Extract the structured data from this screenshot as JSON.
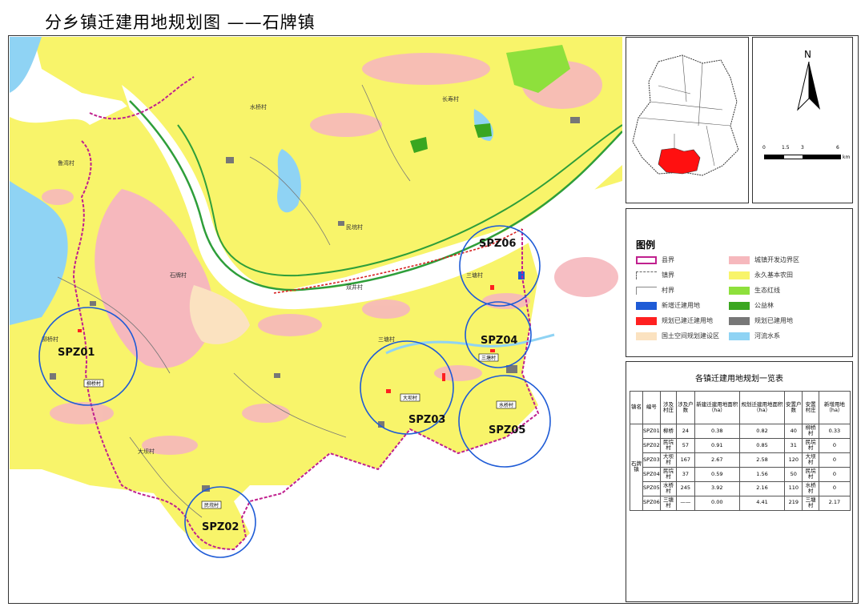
{
  "title": "分乡镇迁建用地规划图 ——石牌镇",
  "zones": [
    "SPZ01",
    "SPZ02",
    "SPZ03",
    "SPZ04",
    "SPZ05",
    "SPZ06"
  ],
  "village_tags": [
    "柳桥村",
    "三塘村",
    "大坝村",
    "民垸村",
    "水桥村"
  ],
  "map_labels": [
    "柳桥村",
    "三塘村",
    "大坝村",
    "民垸村",
    "水桥村",
    "双井村",
    "三塘村",
    "石牌村",
    "鲁湾村",
    "长寿村"
  ],
  "legend": {
    "title": "图例",
    "items": [
      {
        "label": "县界",
        "color": "#c0208e",
        "style": "outline"
      },
      {
        "label": "城镇开发边界区",
        "color": "#f6b8bd",
        "style": "fill"
      },
      {
        "label": "镇界",
        "color": "#666666",
        "style": "dash"
      },
      {
        "label": "永久基本农田",
        "color": "#f8f46a",
        "style": "fill"
      },
      {
        "label": "村界",
        "color": "#888888",
        "style": "line"
      },
      {
        "label": "生态红线",
        "color": "#8ee03c",
        "style": "fill"
      },
      {
        "label": "新增迁建用地",
        "color": "#1e5bd6",
        "style": "fill"
      },
      {
        "label": "公益林",
        "color": "#3aa620",
        "style": "fill"
      },
      {
        "label": "规划已建迁建用地",
        "color": "#ff2020",
        "style": "fill"
      },
      {
        "label": "规划已建用地",
        "color": "#777777",
        "style": "fill"
      },
      {
        "label": "国土空间规划建设区",
        "color": "#fbe2c0",
        "style": "fill"
      },
      {
        "label": "河流水系",
        "color": "#8fd3f4",
        "style": "fill"
      }
    ]
  },
  "table": {
    "title": "各镇迁建用地规划一览表",
    "headers": [
      "镇名",
      "编号",
      "涉及村庄",
      "涉及户数",
      "新建迁建用地面积（ha）",
      "规划迁建用地面积（ha）",
      "安置户数",
      "安置村庄",
      "新增用地（ha）"
    ],
    "town": "石牌镇",
    "rows": [
      [
        "SPZ01",
        "柳桥",
        "24",
        "0.38",
        "0.82",
        "40",
        "柳桥村",
        "0.33"
      ],
      [
        "SPZ02",
        "民垸村",
        "57",
        "0.91",
        "0.85",
        "31",
        "民垸村",
        "0"
      ],
      [
        "SPZ03",
        "大坝村",
        "167",
        "2.67",
        "2.58",
        "120",
        "大坝村",
        "0"
      ],
      [
        "SPZ04",
        "民垸村",
        "37",
        "0.59",
        "1.56",
        "50",
        "民垸村",
        "0"
      ],
      [
        "SPZ05",
        "水桥村",
        "245",
        "3.92",
        "2.16",
        "110",
        "水桥村",
        "0"
      ],
      [
        "SPZ06",
        "三塘村",
        "——",
        "0.00",
        "4.41",
        "219",
        "三塘村",
        "2.17"
      ]
    ]
  },
  "north": {
    "letter": "N",
    "scale_ticks": [
      "0",
      "1.5",
      "3",
      "6"
    ],
    "unit": "km"
  },
  "colors": {
    "county_border": "#c0208e",
    "circle": "#1e5bd6",
    "farmland": "#f8f46a",
    "water": "#8fd3f4",
    "urban": "#f6b8bd",
    "green": "#2e9e3a"
  }
}
